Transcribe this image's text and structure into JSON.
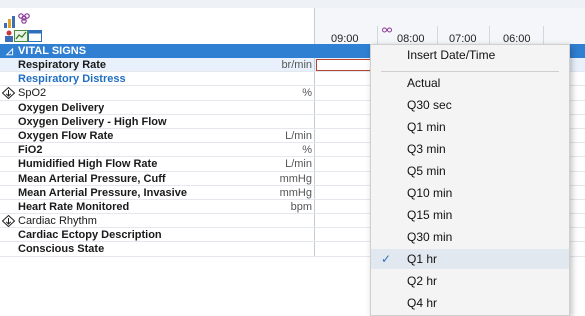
{
  "time_header": {
    "times": [
      "09:00",
      "08:00",
      "07:00",
      "06:00"
    ]
  },
  "flowsheet": {
    "section_title": "VITAL SIGNS",
    "rows": [
      {
        "label": "Respiratory Rate",
        "unit": "br/min"
      },
      {
        "label": "Respiratory Distress",
        "unit": ""
      },
      {
        "label": "SpO2",
        "unit": "%"
      },
      {
        "label": "Oxygen Delivery",
        "unit": ""
      },
      {
        "label": "Oxygen Delivery - High Flow",
        "unit": ""
      },
      {
        "label": "Oxygen Flow Rate",
        "unit": "L/min"
      },
      {
        "label": "FiO2",
        "unit": "%"
      },
      {
        "label": "Humidified High Flow Rate",
        "unit": "L/min"
      },
      {
        "label": "Mean Arterial Pressure, Cuff",
        "unit": "mmHg"
      },
      {
        "label": "Mean Arterial Pressure, Invasive",
        "unit": "mmHg"
      },
      {
        "label": "Heart Rate Monitored",
        "unit": "bpm"
      },
      {
        "label": "Cardiac Rhythm",
        "unit": ""
      },
      {
        "label": "Cardiac Ectopy Description",
        "unit": ""
      },
      {
        "label": "Conscious State",
        "unit": ""
      }
    ]
  },
  "context_menu": {
    "insert_label": "Insert Date/Time",
    "items": [
      "Actual",
      "Q30 sec",
      "Q1 min",
      "Q3 min",
      "Q5 min",
      "Q10 min",
      "Q15 min",
      "Q30 min",
      "Q1 hr",
      "Q2 hr",
      "Q4 hr"
    ],
    "checked_item": "Q1 hr",
    "check_glyph": "✓"
  },
  "colors": {
    "section_header": "#2f7fd2",
    "link_text": "#1f6fc2",
    "edit_border": "#b4442f"
  }
}
